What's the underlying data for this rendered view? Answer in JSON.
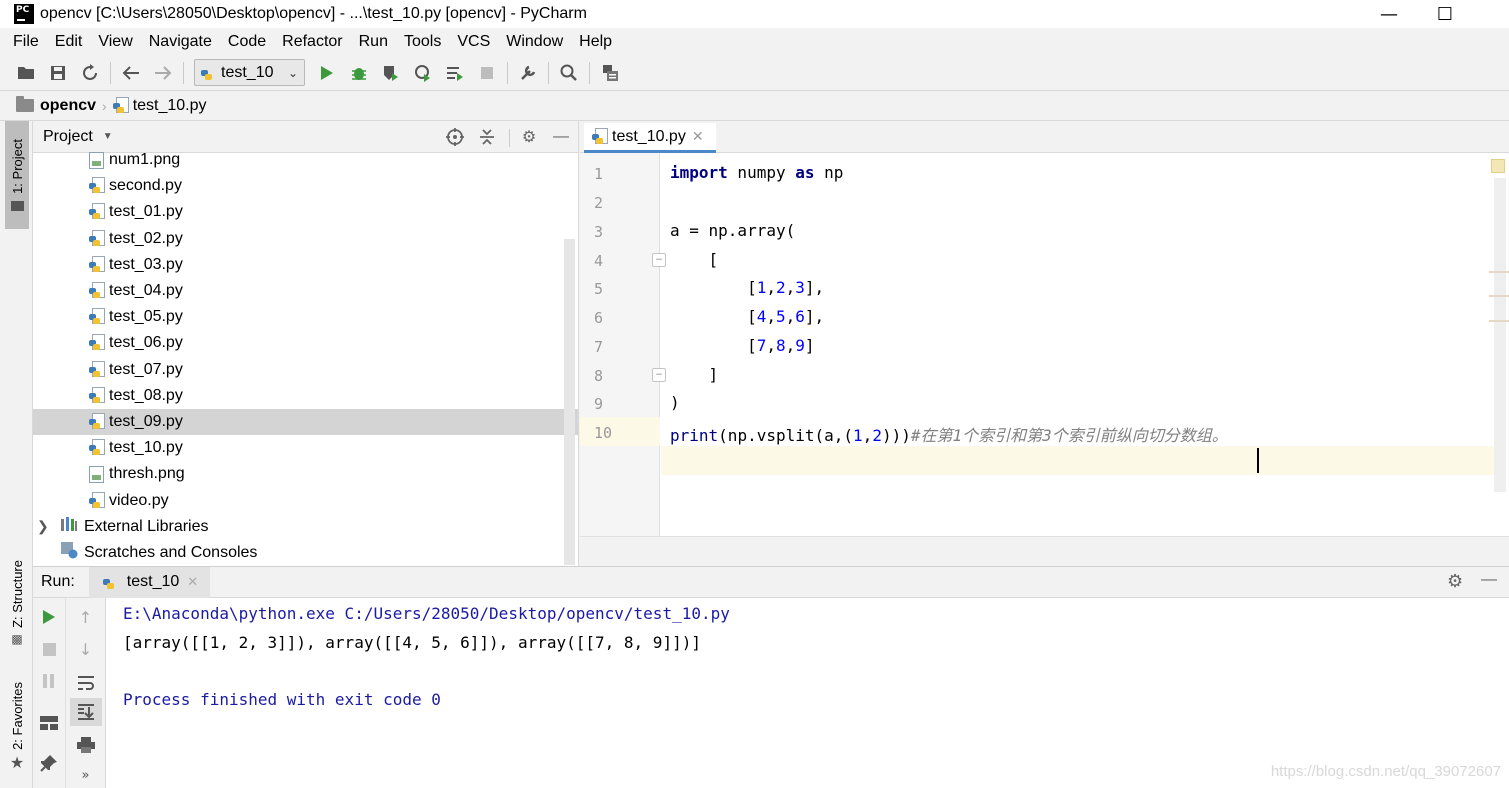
{
  "window": {
    "title": "opencv [C:\\Users\\28050\\Desktop\\opencv] - ...\\test_10.py [opencv] - PyCharm",
    "app_icon_text": "PC",
    "minimize": "—",
    "maximize": "☐"
  },
  "menu": [
    "File",
    "Edit",
    "View",
    "Navigate",
    "Code",
    "Refactor",
    "Run",
    "Tools",
    "VCS",
    "Window",
    "Help"
  ],
  "toolbar": {
    "run_config": "test_10",
    "icons": [
      "open-icon",
      "save-icon",
      "sync-icon",
      "back-icon",
      "forward-icon",
      "run-icon",
      "debug-icon",
      "coverage-icon",
      "profile-icon",
      "concurrency-icon",
      "stop-icon",
      "wrench-icon",
      "search-icon",
      "sdk-icon"
    ]
  },
  "breadcrumb": {
    "project": "opencv",
    "file": "test_10.py"
  },
  "left_strip": {
    "project_tab": "1: Project",
    "structure_tab": "Z: Structure",
    "favorites_tab": "2: Favorites"
  },
  "project_panel": {
    "title": "Project",
    "files": [
      {
        "name": "num1.png",
        "type": "png"
      },
      {
        "name": "second.py",
        "type": "py"
      },
      {
        "name": "test_01.py",
        "type": "py"
      },
      {
        "name": "test_02.py",
        "type": "py"
      },
      {
        "name": "test_03.py",
        "type": "py"
      },
      {
        "name": "test_04.py",
        "type": "py"
      },
      {
        "name": "test_05.py",
        "type": "py"
      },
      {
        "name": "test_06.py",
        "type": "py"
      },
      {
        "name": "test_07.py",
        "type": "py"
      },
      {
        "name": "test_08.py",
        "type": "py"
      },
      {
        "name": "test_09.py",
        "type": "py",
        "selected": true
      },
      {
        "name": "test_10.py",
        "type": "py"
      },
      {
        "name": "thresh.png",
        "type": "png"
      },
      {
        "name": "video.py",
        "type": "py"
      }
    ],
    "external_libraries": "External Libraries",
    "scratches": "Scratches and Consoles"
  },
  "editor": {
    "tab": "test_10.py",
    "line_numbers": [
      "1",
      "2",
      "3",
      "4",
      "5",
      "6",
      "7",
      "8",
      "9",
      "10"
    ],
    "current_line": 10
  },
  "run_panel": {
    "label": "Run:",
    "tab": "test_10",
    "console": [
      "E:\\Anaconda\\python.exe C:/Users/28050/Desktop/opencv/test_10.py",
      "[array([[1, 2, 3]]), array([[4, 5, 6]]), array([[7, 8, 9]])]",
      "",
      "Process finished with exit code 0"
    ]
  },
  "watermark": "https://blog.csdn.net/qq_39072607",
  "colors": {
    "keyword": "#000080",
    "number": "#0000ff",
    "comment": "#808080",
    "current_line": "#fcfae7",
    "selection": "#d4d4d4",
    "tab_underline": "#4a88c7"
  }
}
